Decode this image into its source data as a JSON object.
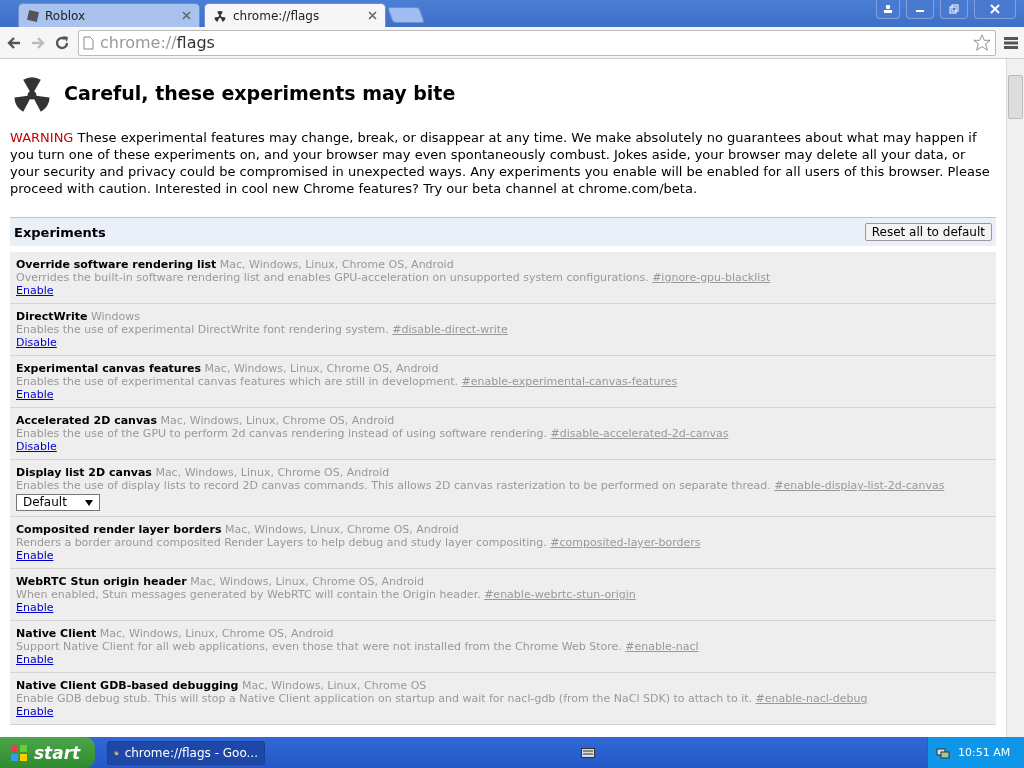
{
  "tabs": [
    {
      "title": "Roblox",
      "selected": false
    },
    {
      "title": "chrome://flags",
      "selected": true
    }
  ],
  "address": {
    "scheme": "chrome://",
    "path": "flags"
  },
  "page": {
    "title": "Careful, these experiments may bite",
    "warning_label": "WARNING",
    "warning_text": "These experimental features may change, break, or disappear at any time. We make absolutely no guarantees about what may happen if you turn one of these experiments on, and your browser may even spontaneously combust. Jokes aside, your browser may delete all your data, or your security and privacy could be compromised in unexpected ways. Any experiments you enable will be enabled for all users of this browser. Please proceed with caution. Interested in cool new Chrome features? Try our beta channel at chrome.com/beta."
  },
  "experiments_header": {
    "title": "Experiments",
    "reset_button": "Reset all to default"
  },
  "experiments": [
    {
      "kind": "link",
      "name": "Override software rendering list",
      "platforms": "Mac, Windows, Linux, Chrome OS, Android",
      "description": "Overrides the built-in software rendering list and enables GPU-acceleration on unsupported system configurations.",
      "anchor": "#ignore-gpu-blacklist",
      "action": "Enable"
    },
    {
      "kind": "link",
      "name": "DirectWrite",
      "platforms": "Windows",
      "description": "Enables the use of experimental DirectWrite font rendering system.",
      "anchor": "#disable-direct-write",
      "action": "Disable"
    },
    {
      "kind": "link",
      "name": "Experimental canvas features",
      "platforms": "Mac, Windows, Linux, Chrome OS, Android",
      "description": "Enables the use of experimental canvas features which are still in development.",
      "anchor": "#enable-experimental-canvas-features",
      "action": "Enable"
    },
    {
      "kind": "link",
      "name": "Accelerated 2D canvas",
      "platforms": "Mac, Windows, Linux, Chrome OS, Android",
      "description": "Enables the use of the GPU to perform 2d canvas rendering instead of using software rendering.",
      "anchor": "#disable-accelerated-2d-canvas",
      "action": "Disable"
    },
    {
      "kind": "select",
      "name": "Display list 2D canvas",
      "platforms": "Mac, Windows, Linux, Chrome OS, Android",
      "description": "Enables the use of display lists to record 2D canvas commands. This allows 2D canvas rasterization to be performed on separate thread.",
      "anchor": "#enable-display-list-2d-canvas",
      "action": "Default"
    },
    {
      "kind": "link",
      "name": "Composited render layer borders",
      "platforms": "Mac, Windows, Linux, Chrome OS, Android",
      "description": "Renders a border around composited Render Layers to help debug and study layer compositing.",
      "anchor": "#composited-layer-borders",
      "action": "Enable"
    },
    {
      "kind": "link",
      "name": "WebRTC Stun origin header",
      "platforms": "Mac, Windows, Linux, Chrome OS, Android",
      "description": "When enabled, Stun messages generated by WebRTC will contain the Origin header.",
      "anchor": "#enable-webrtc-stun-origin",
      "action": "Enable"
    },
    {
      "kind": "link",
      "name": "Native Client",
      "platforms": "Mac, Windows, Linux, Chrome OS, Android",
      "description": "Support Native Client for all web applications, even those that were not installed from the Chrome Web Store.",
      "anchor": "#enable-nacl",
      "action": "Enable"
    },
    {
      "kind": "link",
      "name": "Native Client GDB-based debugging",
      "platforms": "Mac, Windows, Linux, Chrome OS",
      "description": "Enable GDB debug stub. This will stop a Native Client application on startup and wait for nacl-gdb (from the NaCl SDK) to attach to it.",
      "anchor": "#enable-nacl-debug",
      "action": "Enable"
    }
  ],
  "taskbar": {
    "start": "start",
    "tasks": [
      {
        "title": "chrome://flags - Goo...",
        "selected": true
      }
    ],
    "clock": "10:51 AM"
  }
}
